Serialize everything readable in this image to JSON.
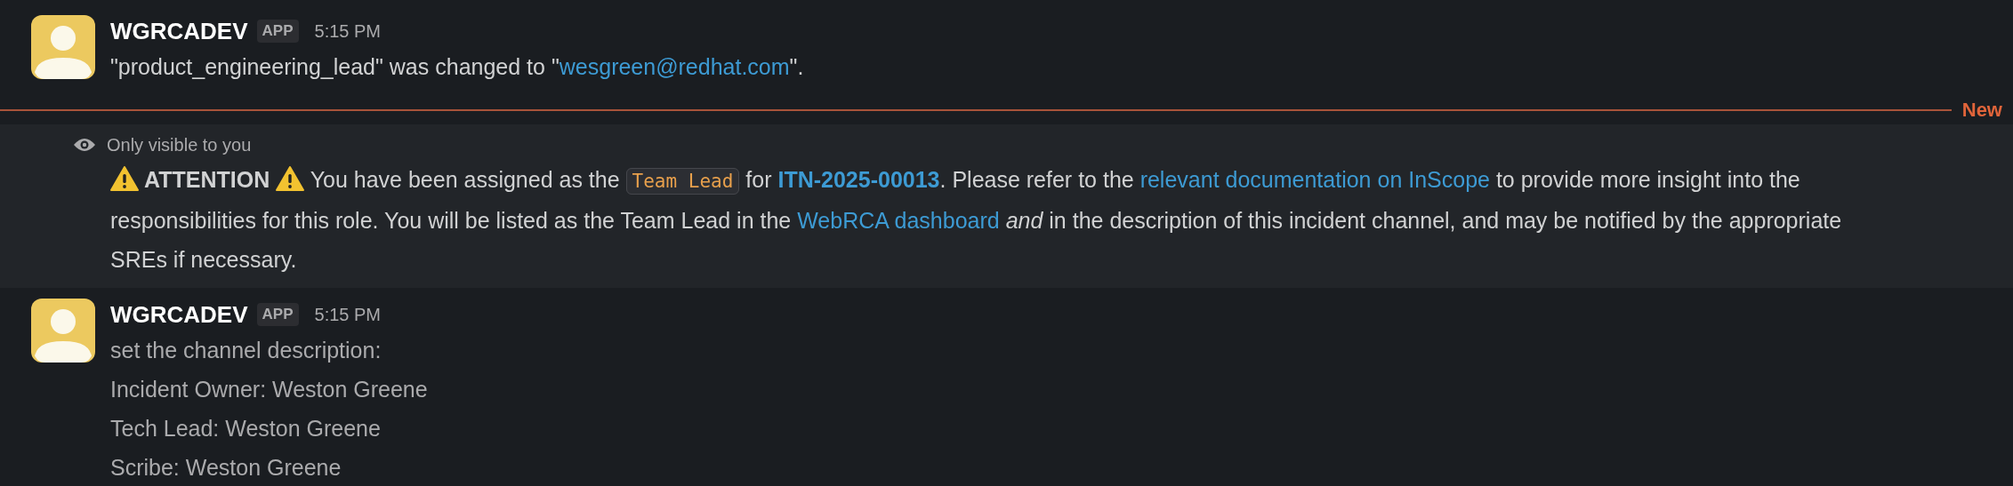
{
  "messages": [
    {
      "sender": "WGRCADEV",
      "badge": "APP",
      "time": "5:15 PM",
      "lines": [
        [
          {
            "kind": "text",
            "text": "\"product_engineering_lead\" was changed to \""
          },
          {
            "kind": "link",
            "text": "wesgreen@redhat.com"
          },
          {
            "kind": "text",
            "text": "\"."
          }
        ]
      ]
    }
  ],
  "divider": {
    "label": "New"
  },
  "ephemeral": {
    "notice": "Only visible to you",
    "segments": [
      {
        "kind": "warning"
      },
      {
        "kind": "bold",
        "text": " ATTENTION "
      },
      {
        "kind": "warning"
      },
      {
        "kind": "text",
        "text": " You have been assigned as the "
      },
      {
        "kind": "code",
        "text": "Team Lead"
      },
      {
        "kind": "text",
        "text": " for "
      },
      {
        "kind": "boldlink",
        "text": "ITN-2025-00013"
      },
      {
        "kind": "text",
        "text": ". Please refer to the "
      },
      {
        "kind": "link",
        "text": "relevant documentation on InScope"
      },
      {
        "kind": "text",
        "text": " to provide more insight into the responsibilities for this role. You will be listed as the Team Lead in the "
      },
      {
        "kind": "link",
        "text": "WebRCA dashboard"
      },
      {
        "kind": "italic",
        "text": " and"
      },
      {
        "kind": "text",
        "text": " in the description of this incident channel, and may be notified by the appropriate SREs if necessary."
      }
    ]
  },
  "messages_after": [
    {
      "sender": "WGRCADEV",
      "badge": "APP",
      "time": "5:15 PM",
      "lines": [
        [
          {
            "kind": "text",
            "text": "set the channel description:"
          }
        ],
        [
          {
            "kind": "text",
            "text": "Incident Owner: Weston Greene"
          }
        ],
        [
          {
            "kind": "text",
            "text": "Tech Lead: Weston Greene"
          }
        ],
        [
          {
            "kind": "text",
            "text": "Scribe: Weston Greene"
          }
        ]
      ]
    }
  ]
}
